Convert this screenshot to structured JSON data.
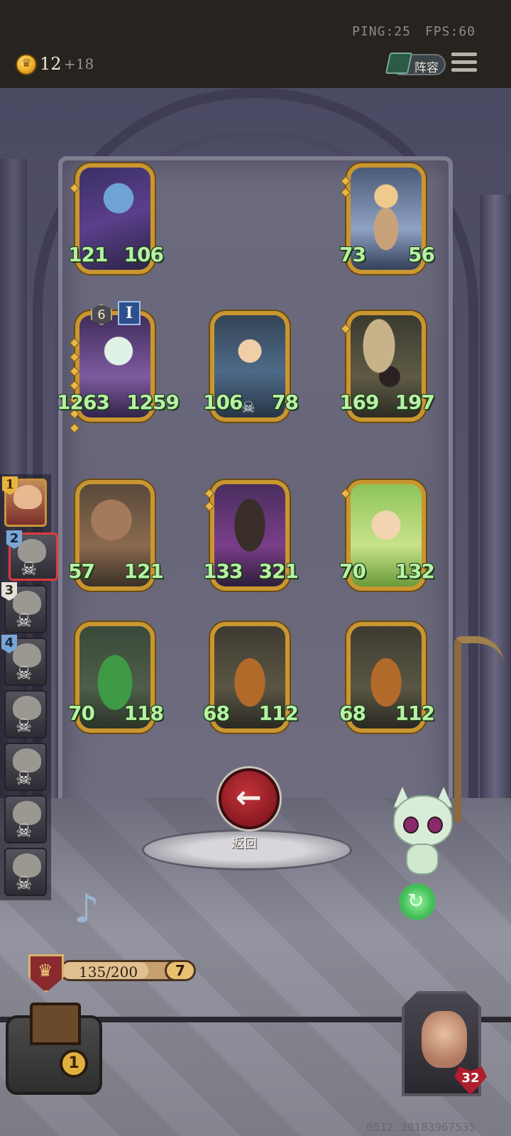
{
  "status": {
    "ping": "PING:25",
    "fps": "FPS:60"
  },
  "resources": {
    "gold": "12",
    "gold_income": "+18"
  },
  "topbar": {
    "lineup_label": "阵容"
  },
  "board": {
    "cards": [
      {
        "name": "mage",
        "atk": "121",
        "hp": "106"
      },
      {
        "name": "king",
        "atk": "73",
        "hp": "56"
      },
      {
        "name": "kirin",
        "atk": "1263",
        "hp": "1259",
        "stars": "6",
        "rank": "I"
      },
      {
        "name": "archer",
        "atk": "106",
        "hp": "78"
      },
      {
        "name": "spider",
        "atk": "169",
        "hp": "197"
      },
      {
        "name": "treant",
        "atk": "57",
        "hp": "121"
      },
      {
        "name": "golem",
        "atk": "133",
        "hp": "321"
      },
      {
        "name": "girl",
        "atk": "70",
        "hp": "132"
      },
      {
        "name": "cactus",
        "atk": "70",
        "hp": "118"
      },
      {
        "name": "pumpkin",
        "atk": "68",
        "hp": "112"
      },
      {
        "name": "pumpkin",
        "atk": "68",
        "hp": "112"
      }
    ]
  },
  "roster": {
    "slots": [
      "1",
      "2",
      "3",
      "4"
    ]
  },
  "actions": {
    "back_label": "返回"
  },
  "player": {
    "xp": "135/200",
    "xp_fraction": 0.675,
    "level": "7",
    "chest_count": "1",
    "health": "32"
  },
  "footer": {
    "coords": "0512.30183967535"
  }
}
